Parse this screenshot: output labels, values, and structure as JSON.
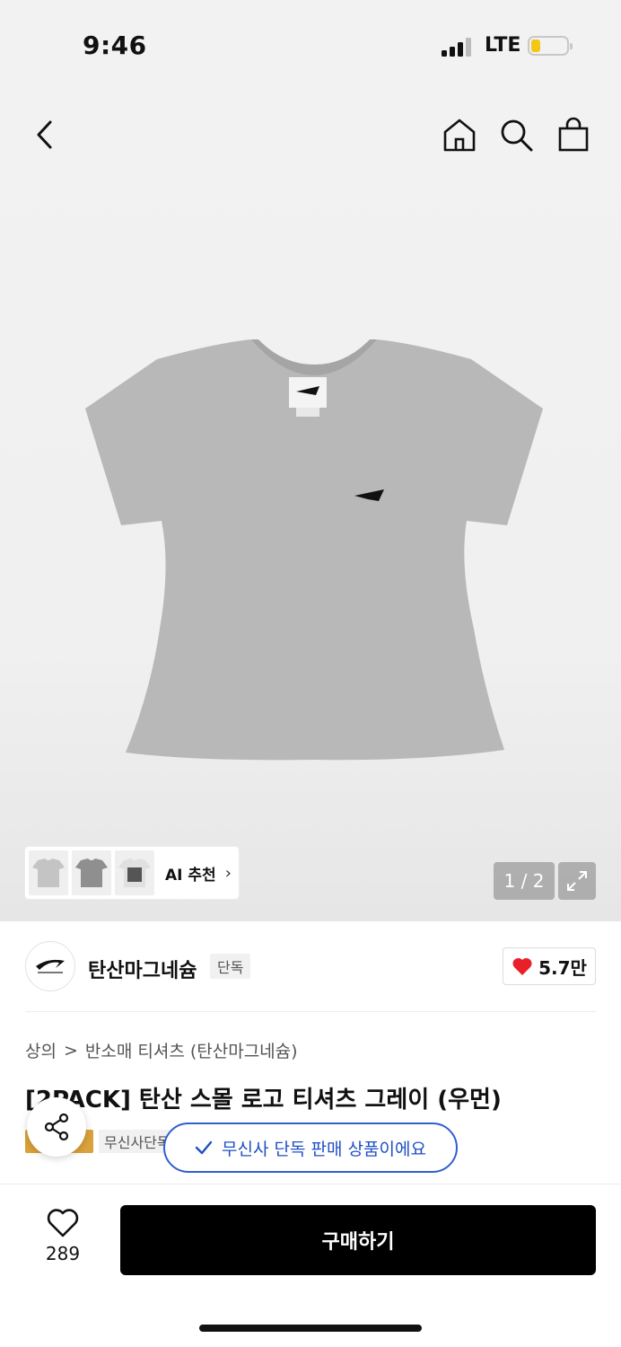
{
  "status_bar": {
    "time": "9:46",
    "network": "LTE",
    "battery_color": "#f5c518"
  },
  "nav": {
    "back_icon": "chevron-left-icon",
    "home_icon": "home-icon",
    "search_icon": "search-icon",
    "cart_icon": "shopping-bag-icon"
  },
  "gallery": {
    "ai_label": "AI 추천",
    "page_indicator": "1 / 2",
    "thumbnails": [
      "grey-tshirt",
      "grey-tshirt-dark",
      "printed-tshirt"
    ]
  },
  "brand": {
    "name": "탄산마그네슘",
    "badge": "단독",
    "likes": "5.7만",
    "heart_color": "#e8202a"
  },
  "breadcrumb": {
    "category": "상의",
    "separator": ">",
    "subcategory": "반소매 티셔츠 (탄산마그네슘)"
  },
  "product": {
    "title": "[2PACK] 탄산 스몰 로고 티셔츠 그레이 (우먼)",
    "tag_label": "무신사단독",
    "exclusive_notice": "무신사 단독 판매 상품이에요"
  },
  "bottom_bar": {
    "wish_count": "289",
    "buy_label": "구매하기"
  }
}
